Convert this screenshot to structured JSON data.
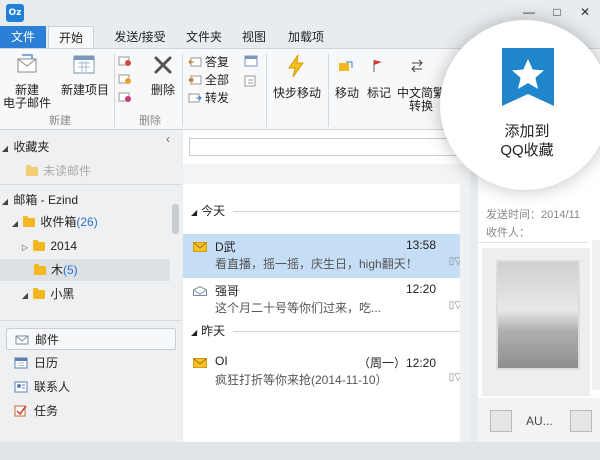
{
  "window": {
    "logo_text": "Oz",
    "controls": {
      "minimize": "—",
      "maximize": "□",
      "close": "✕"
    }
  },
  "menu_tabs": [
    "文件",
    "开始",
    "发送/接受",
    "文件夹",
    "视图",
    "加载项"
  ],
  "ribbon": {
    "new_mail_line1": "新建",
    "new_mail_line2": "电子邮件",
    "new_item": "新建项目",
    "group_new": "新建",
    "delete": "删除",
    "group_delete": "删除",
    "reply": "答复",
    "reply_all": "全部",
    "forward": "转发",
    "quick_move": "快步移动",
    "move": "移动",
    "mark": "标记",
    "chinese_line1": "中文简繁",
    "chinese_line2": "转换"
  },
  "spotlight": {
    "line1": "添加到",
    "line2": "QQ收藏",
    "badge_color": "#1f86cc"
  },
  "left_pane": {
    "favorites": "收藏夹",
    "unread": "未读邮件",
    "mailbox": "邮箱 - Ezind",
    "inbox": "收件箱",
    "inbox_count": "(26)",
    "folder_2014": "2014",
    "folder_mu": "木",
    "folder_mu_count": "(5)",
    "folder_xiaohei": "小黑",
    "nav": [
      "邮件",
      "日历",
      "联系人",
      "任务"
    ]
  },
  "messages": {
    "group_today": "今天",
    "group_yesterday": "昨天",
    "items": [
      {
        "sender": "D武",
        "time": "13:58",
        "preview": "看直播，摇一摇，庆生日，high翻天！"
      },
      {
        "sender": "强哥",
        "time": "12:20",
        "preview": "这个月二十号等你们过来，吃..."
      },
      {
        "sender": "OI",
        "time": "（周一）12:20",
        "preview": "疯狂打折等你来抢(2014-11-10）"
      }
    ],
    "flags": "▯▽"
  },
  "reading_pane": {
    "sent_time": "发送时间：2014/11",
    "recipient": "收件人：",
    "bottom_name": "AU..."
  },
  "colors": {
    "accent": "#2b7fd6",
    "selected_row": "#c5ddf5",
    "count_blue": "#2b6fd1",
    "folder_yellow": "#f3b81f"
  }
}
